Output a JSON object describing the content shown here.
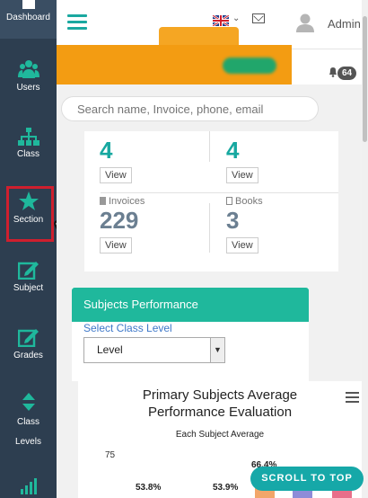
{
  "sidebar": {
    "items": [
      {
        "label": "Dashboard",
        "icon": "home-icon"
      },
      {
        "label": "Users",
        "icon": "users-icon"
      },
      {
        "label": "Class",
        "icon": "sitemap-icon"
      },
      {
        "label": "Section",
        "icon": "star-icon"
      },
      {
        "label": "Subject",
        "icon": "edit-icon"
      },
      {
        "label": "Grades",
        "icon": "edit-icon"
      },
      {
        "label_line1": "Class",
        "label_line2": "Levels",
        "icon": "sort-icon"
      },
      {
        "label": "",
        "icon": "bar-chart-icon"
      }
    ]
  },
  "topbar": {
    "admin_label": "Admin",
    "notification_count": "64",
    "language_flag": "uk-flag-icon"
  },
  "search": {
    "placeholder": "Search name, Invoice, phone, email"
  },
  "stats": [
    {
      "label": "",
      "value": "4",
      "button": "View"
    },
    {
      "label": "",
      "value": "4",
      "button": "View"
    },
    {
      "label": "Invoices",
      "value": "229",
      "button": "View"
    },
    {
      "label": "Books",
      "value": "3",
      "button": "View"
    }
  ],
  "subjects_panel": {
    "title": "Subjects Performance",
    "select_label": "Select Class Level",
    "select_value": "Level"
  },
  "chart_data": {
    "type": "bar",
    "title_line1": "Primary Subjects Average",
    "title_line2": "Performance Evaluation",
    "subtitle": "Each Subject Average",
    "y_ticks": [
      "75"
    ],
    "values": [
      53.8,
      53.9,
      66.4
    ],
    "value_labels": [
      "53.8%",
      "53.9%",
      "66.4%"
    ],
    "colors": {
      "partial_bars": [
        "#f2a66a",
        "#8e8cd8",
        "#e86f8a"
      ]
    }
  },
  "scroll_top_label": "SCROLL TO TOP",
  "colors": {
    "sidebar_bg": "#2d3e50",
    "accent_teal": "#1aa8a0",
    "panel_green": "#1fb89c",
    "banner_orange": "#f39c12",
    "active_border": "#cf1f2e"
  }
}
